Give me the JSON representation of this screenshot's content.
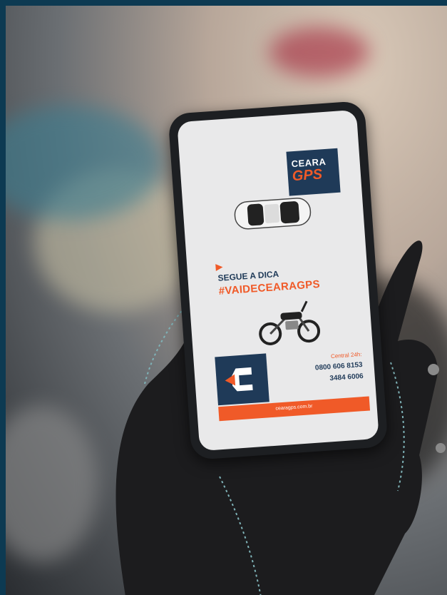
{
  "colors": {
    "frame": "#0d3a52",
    "navy": "#1f3a58",
    "orange": "#f05a28",
    "screen": "#e9e9ea",
    "glove": "#1c1c1e"
  },
  "phone_screen": {
    "logo_top": "CEARA",
    "logo_bottom": "GPS",
    "side_text": "",
    "tagline": "SEGUE A DICA",
    "hashtag": "#VAIDECEARAGPS",
    "central_label": "Central 24h:",
    "phone_1": "0800 606 8153",
    "phone_2": "3484 6006",
    "website": "cearagps.com.br",
    "icons": [
      "car-image",
      "motorcycle-image",
      "cearagps-brand-logo"
    ]
  }
}
